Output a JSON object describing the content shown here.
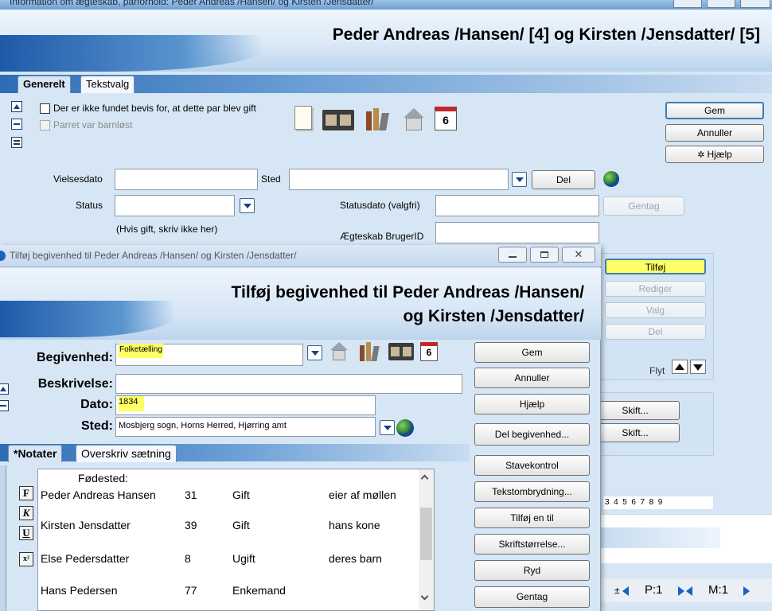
{
  "main_window": {
    "title": "Information om ægteskab, parforhold: Peder Andreas /Hansen/ og Kirsten /Jensdatter/",
    "heading": "Peder Andreas /Hansen/ [4] og Kirsten /Jensdatter/ [5]",
    "tabs": [
      "Generelt",
      "Tekstvalg"
    ],
    "no_proof_label": "Der er ikke fundet bevis for, at dette par blev gift",
    "childless_label": "Parret var barnløst",
    "gem": "Gem",
    "annuller": "Annuller",
    "hjaelp": "Hjælp",
    "vielsesdato_label": "Vielsesdato",
    "sted_label": "Sted",
    "del_button": "Del",
    "status_label": "Status",
    "statusdato_label": "Statusdato (valgfri)",
    "gentag": "Gentag",
    "hint": "(Hvis gift, skriv ikke her)",
    "brugerid_label": "Ægteskab BrugerID",
    "tilfoj": "Tilføj",
    "rediger": "Rediger",
    "valg": "Valg",
    "del2": "Del",
    "flyt": "Flyt",
    "skift1": "Skift...",
    "skift2": "Skift...",
    "ruler": "3  4  5  6  7  8  9",
    "p_label": "P:1",
    "m_label": "M:1",
    "pm_prefix": "±"
  },
  "dialog": {
    "title": "Tilføj begivenhed til Peder Andreas /Hansen/ og Kirsten /Jensdatter/",
    "heading_line1": "Tilføj begivenhed til Peder Andreas /Hansen/",
    "heading_line2": "og Kirsten /Jensdatter/",
    "begivenhed_label": "Begivenhed:",
    "begivenhed_value": "Folketælling",
    "beskrivelse_label": "Beskrivelse:",
    "beskrivelse_value": "",
    "dato_label": "Dato:",
    "dato_value": "1834",
    "sted_label": "Sted:",
    "sted_value": "Mosbjerg sogn, Horns Herred, Hjørring amt",
    "tabs": [
      "*Notater",
      "Overskriv sætning"
    ],
    "buttons": {
      "gem": "Gem",
      "annuller": "Annuller",
      "hjaelp": "Hjælp",
      "del_begivenhed": "Del begivenhed...",
      "stavekontrol": "Stavekontrol",
      "tekstombrydning": "Tekstombrydning...",
      "tilfoj_en_til": "Tilføj en til",
      "skriftstorrelse": "Skriftstørrelse...",
      "ryd": "Ryd",
      "gentag": "Gentag"
    },
    "format_buttons": [
      "F",
      "K",
      "U",
      "x²"
    ],
    "notes": {
      "header": "Fødested:",
      "rows": [
        {
          "name": "Peder Andreas Hansen",
          "age": "31",
          "status": "Gift",
          "role": "eier af møllen"
        },
        {
          "name": "Kirsten Jensdatter",
          "age": "39",
          "status": "Gift",
          "role": "hans kone"
        },
        {
          "name": "Else Pedersdatter",
          "age": "8",
          "status": "Ugift",
          "role": "deres barn"
        },
        {
          "name": "Hans Pedersen",
          "age": "77",
          "status": "Enkemand",
          "role": ""
        }
      ]
    }
  },
  "colors": {
    "highlight": "#ffff66",
    "accent": "#3c7fb1"
  }
}
